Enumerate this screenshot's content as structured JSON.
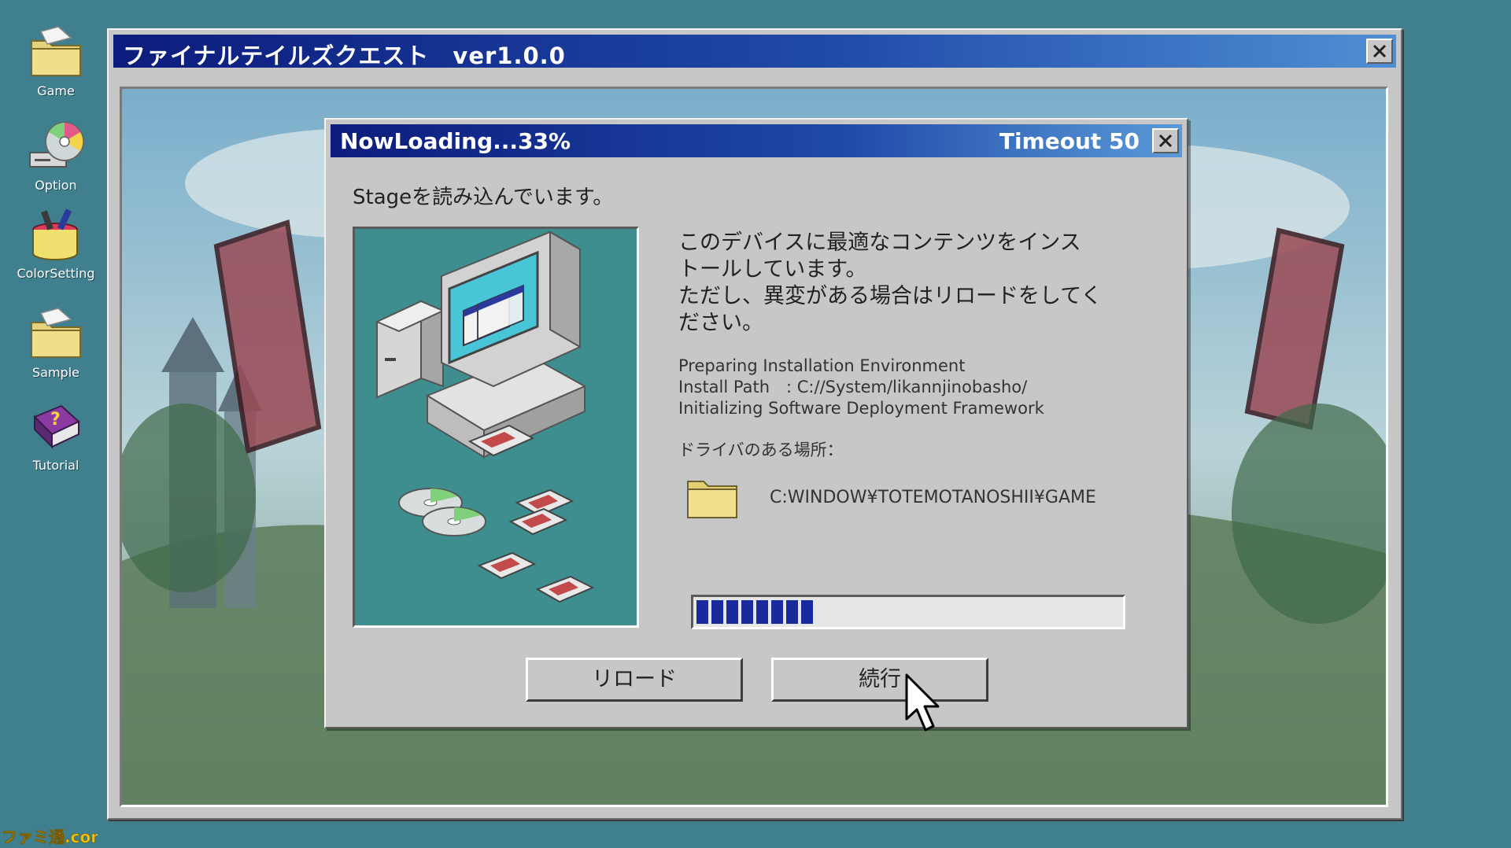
{
  "desktop": {
    "icons": [
      {
        "label": "Game",
        "icon": "folder-icon"
      },
      {
        "label": "Option",
        "icon": "cd-drive-icon"
      },
      {
        "label": "ColorSetting",
        "icon": "paint-bucket-icon"
      },
      {
        "label": "Sample",
        "icon": "folder-icon"
      },
      {
        "label": "Tutorial",
        "icon": "help-book-icon"
      }
    ]
  },
  "main_window": {
    "title": "ファイナルテイルズクエスト　ver1.0.0"
  },
  "dialog": {
    "title": "NowLoading...33%",
    "timeout": "Timeout 50",
    "subtitle": "Stageを読み込んでいます。",
    "message_jp": [
      "このデバイスに最適なコンテンツをインス",
      "トールしています。",
      "ただし、異変がある場合はリロードをしてく",
      "ださい。"
    ],
    "message_en": [
      "Preparing Installation Environment",
      "Install Path　: C://System/likannjinobasho/",
      "Initializing Software Deployment Framework"
    ],
    "driver_label": "ドライバのある場所：",
    "driver_path": "C:WINDOW¥TOTEMOTANOSHII¥GAME",
    "progress_percent": 33,
    "buttons": {
      "reload": "リロード",
      "continue": "続行"
    }
  },
  "watermark": "ファミ通.com",
  "colors": {
    "desktop": "#3f7f8e",
    "titlebar_start": "#0c1c7c",
    "titlebar_end": "#5a9ad8",
    "window": "#c7c7c7",
    "progress_fill": "#1a2a9c",
    "illustration_bg": "#3e8e90",
    "watermark": "#f5c400"
  }
}
